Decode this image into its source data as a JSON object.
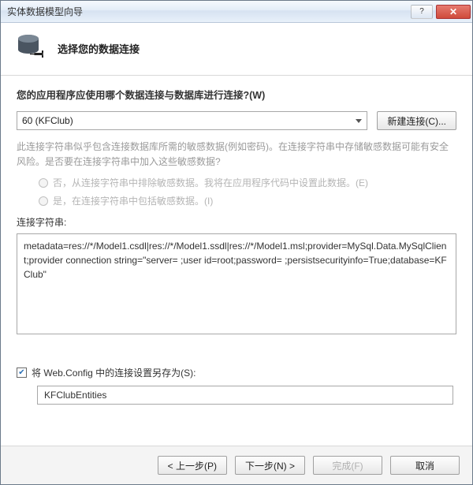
{
  "window": {
    "title": "实体数据模型向导"
  },
  "header": {
    "subtitle": "选择您的数据连接"
  },
  "question": "您的应用程序应使用哪个数据连接与数据库进行连接?(W)",
  "conn": {
    "selected": "60             (KFClub)",
    "new_button": "新建连接(C)..."
  },
  "note": "此连接字符串似乎包含连接数据库所需的敏感数据(例如密码)。在连接字符串中存储敏感数据可能有安全风险。是否要在连接字符串中加入这些敏感数据?",
  "radios": {
    "no": "否，从连接字符串中排除敏感数据。我将在应用程序代码中设置此数据。(E)",
    "yes": "是，在连接字符串中包括敏感数据。(I)"
  },
  "connstr_label": "连接字符串:",
  "connstr_value": "metadata=res://*/Model1.csdl|res://*/Model1.ssdl|res://*/Model1.msl;provider=MySql.Data.MySqlClient;provider connection string=\"server=            ;user id=root;password=       ;persistsecurityinfo=True;database=KFClub\"",
  "save": {
    "checked": true,
    "label": "将 Web.Config 中的连接设置另存为(S):",
    "value": "KFClubEntities"
  },
  "footer": {
    "prev": "< 上一步(P)",
    "next": "下一步(N) >",
    "finish": "完成(F)",
    "cancel": "取消"
  }
}
